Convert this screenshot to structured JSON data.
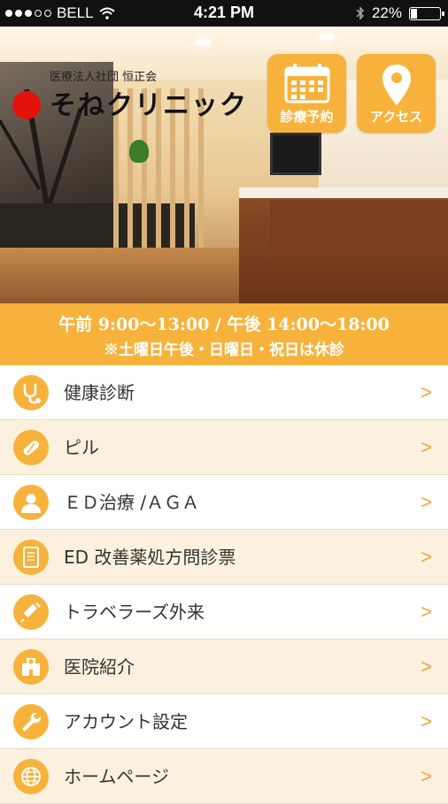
{
  "status_bar": {
    "carrier": "BELL",
    "time": "4:21 PM",
    "battery": "22%",
    "battery_level": 0.22,
    "icons": [
      "signal-dots",
      "wifi-icon",
      "bluetooth-icon",
      "battery-icon"
    ]
  },
  "header": {
    "clinic_subtitle": "医療法人社団 恒正会",
    "clinic_name": "そねクリニック",
    "buttons": [
      {
        "label": "診療予約",
        "icon": "calendar-icon"
      },
      {
        "label": "アクセス",
        "icon": "map-pin-icon"
      }
    ]
  },
  "hours": {
    "line1": "午前 9:00〜13:00 / 午後 14:00〜18:00",
    "line2": "※土曜日午後・日曜日・祝日は休診"
  },
  "menu": {
    "arrow": ">",
    "items": [
      {
        "label": "健康診断",
        "icon": "stethoscope-icon"
      },
      {
        "label": "ピル",
        "icon": "pill-icon"
      },
      {
        "label": "ＥＤ治療 /ＡＧＡ",
        "icon": "person-icon"
      },
      {
        "label": "ED 改善薬処方問診票",
        "icon": "document-icon"
      },
      {
        "label": "トラベラーズ外来",
        "icon": "syringe-icon"
      },
      {
        "label": "医院紹介",
        "icon": "clinic-building-icon"
      },
      {
        "label": "アカウント設定",
        "icon": "wrench-icon"
      },
      {
        "label": "ホームページ",
        "icon": "globe-icon"
      }
    ]
  },
  "colors": {
    "accent": "#f7b23c",
    "row_alt": "#fbf1de",
    "brand_red": "#e3120b"
  }
}
